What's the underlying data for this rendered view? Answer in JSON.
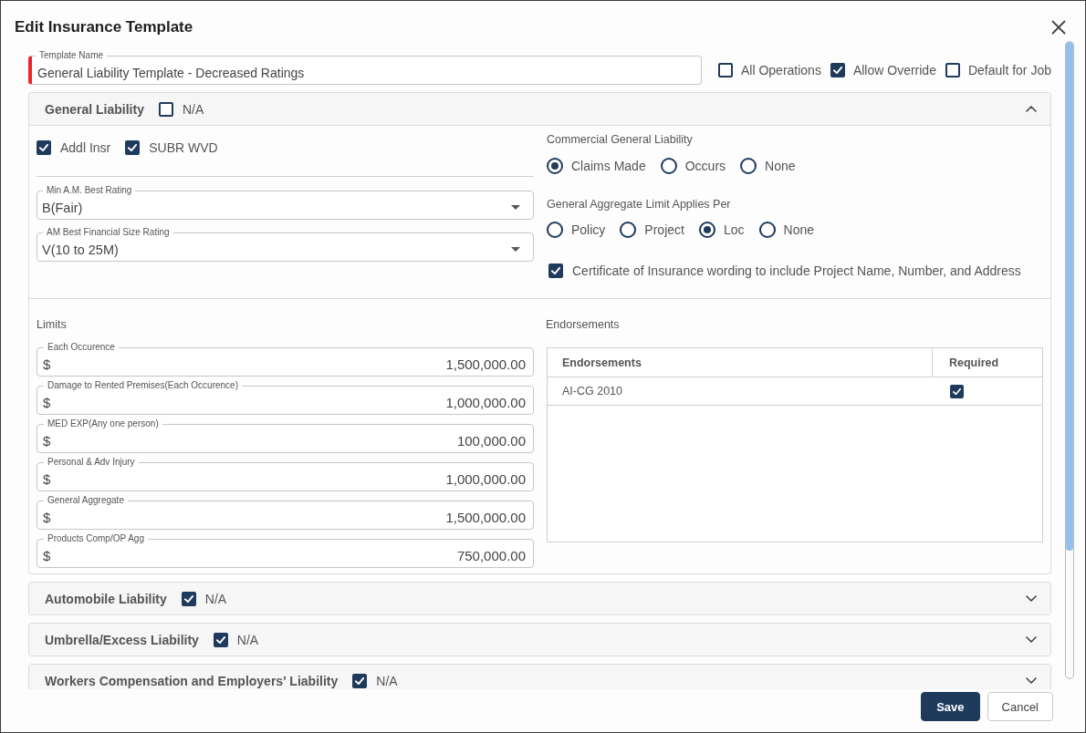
{
  "dialog": {
    "title": "Edit Insurance Template"
  },
  "template_name": {
    "label": "Template Name",
    "value": "General Liability Template - Decreased Ratings",
    "required": true
  },
  "options": [
    {
      "label": "All Operations",
      "checked": false
    },
    {
      "label": "Allow Override",
      "checked": true
    },
    {
      "label": "Default for Job",
      "checked": false
    }
  ],
  "sections": [
    {
      "title": "General Liability",
      "na": {
        "label": "N/A",
        "checked": false
      },
      "expanded": true,
      "body": {
        "coverages": [
          {
            "label": "Addl Insr",
            "checked": true
          },
          {
            "label": "SUBR WVD",
            "checked": true
          }
        ],
        "ratings": [
          {
            "label": "Min A.M. Best Rating",
            "value": "B(Fair)"
          },
          {
            "label": "AM Best Financial Size Rating",
            "value": "V(10 to 25M)"
          }
        ],
        "radio_groups": [
          {
            "label": "Commercial General Liability",
            "options": [
              {
                "label": "Claims Made",
                "selected": true
              },
              {
                "label": "Occurs",
                "selected": false
              },
              {
                "label": "None",
                "selected": false
              }
            ]
          },
          {
            "label": "General Aggregate Limit Applies Per",
            "options": [
              {
                "label": "Policy",
                "selected": false
              },
              {
                "label": "Project",
                "selected": false
              },
              {
                "label": "Loc",
                "selected": true
              },
              {
                "label": "None",
                "selected": false
              }
            ]
          }
        ],
        "certificate_wording": {
          "label": "Certificate of Insurance wording to include Project Name, Number, and Address",
          "checked": true
        },
        "limits": {
          "label": "Limits",
          "fields": [
            {
              "label": "Each Occurence",
              "prefix": "$",
              "value": "1,500,000.00"
            },
            {
              "label": "Damage to Rented Premises(Each Occurence)",
              "prefix": "$",
              "value": "1,000,000.00"
            },
            {
              "label": "MED EXP(Any one person)",
              "prefix": "$",
              "value": "100,000.00"
            },
            {
              "label": "Personal & Adv Injury",
              "prefix": "$",
              "value": "1,000,000.00"
            },
            {
              "label": "General Aggregate",
              "prefix": "$",
              "value": "1,500,000.00"
            },
            {
              "label": "Products Comp/OP Agg",
              "prefix": "$",
              "value": "750,000.00"
            }
          ]
        },
        "endorsements": {
          "label": "Endorsements",
          "columns": [
            "Endorsements",
            "Required"
          ],
          "rows": [
            {
              "name": "AI-CG 2010",
              "required": true
            }
          ]
        }
      }
    },
    {
      "title": "Automobile Liability",
      "na": {
        "label": "N/A",
        "checked": true
      },
      "expanded": false
    },
    {
      "title": "Umbrella/Excess Liability",
      "na": {
        "label": "N/A",
        "checked": true
      },
      "expanded": false
    },
    {
      "title": "Workers Compensation and Employers' Liability",
      "na": {
        "label": "N/A",
        "checked": true
      },
      "expanded": false
    }
  ],
  "buttons": [
    {
      "label": "Save",
      "kind": "primary"
    },
    {
      "label": "Cancel",
      "kind": "secondary"
    }
  ]
}
